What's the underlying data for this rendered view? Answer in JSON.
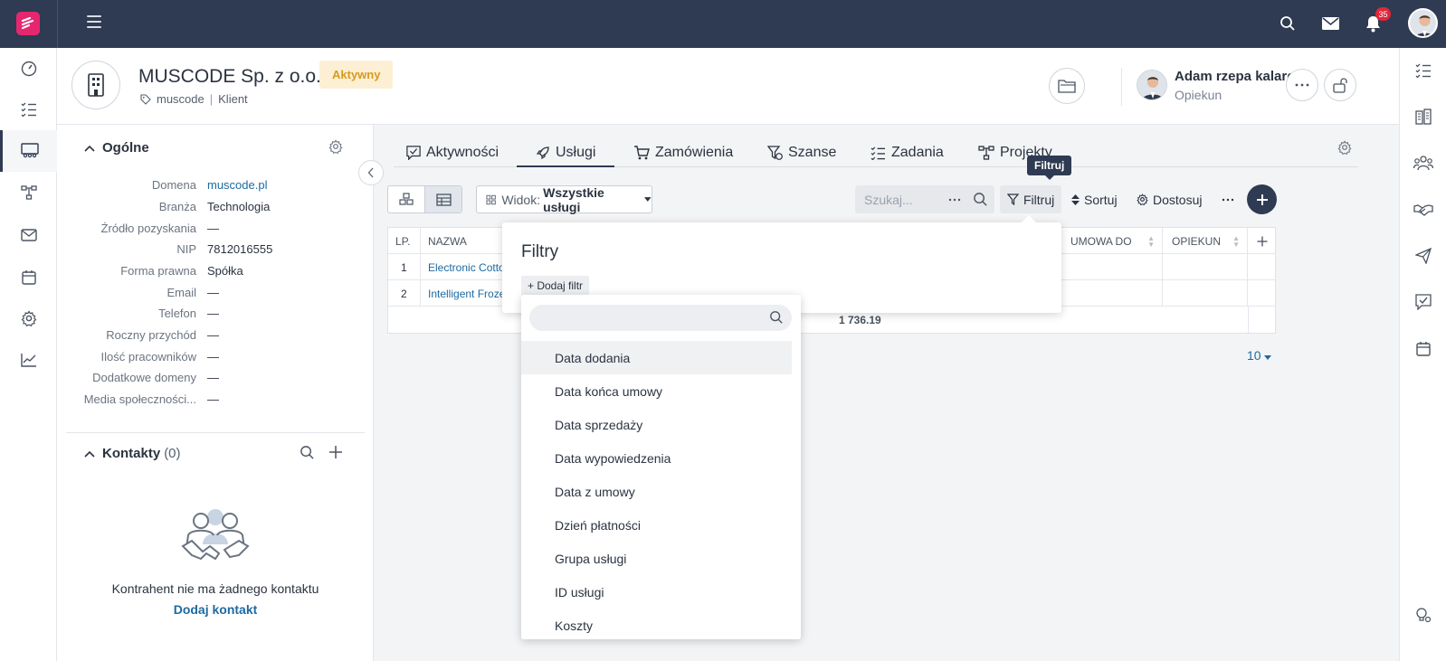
{
  "topbar": {
    "notification_count": "35"
  },
  "header": {
    "company_name": "MUSCODE Sp. z o.o.",
    "status": "Aktywny",
    "tag": "muscode",
    "type": "Klient",
    "owner_name": "Adam rzepa kalarepa",
    "owner_role": "Opiekun"
  },
  "general": {
    "title": "Ogólne",
    "fields": [
      {
        "label": "Domena",
        "value": "muscode.pl"
      },
      {
        "label": "Branża",
        "value": "Technologia"
      },
      {
        "label": "Źródło pozyskania",
        "value": "—"
      },
      {
        "label": "NIP",
        "value": "7812016555"
      },
      {
        "label": "Forma prawna",
        "value": "Spółka"
      },
      {
        "label": "Email",
        "value": "—"
      },
      {
        "label": "Telefon",
        "value": "—"
      },
      {
        "label": "Roczny przychód",
        "value": "—"
      },
      {
        "label": "Ilość pracowników",
        "value": "—"
      },
      {
        "label": "Dodatkowe domeny",
        "value": "—"
      },
      {
        "label": "Media społeczności...",
        "value": "—"
      }
    ]
  },
  "contacts": {
    "title": "Kontakty",
    "count": "(0)",
    "empty_text": "Kontrahent nie ma żadnego kontaktu",
    "add_label": "Dodaj kontakt"
  },
  "tabs": [
    {
      "label": "Aktywności"
    },
    {
      "label": "Usługi"
    },
    {
      "label": "Zamówienia"
    },
    {
      "label": "Szanse"
    },
    {
      "label": "Zadania"
    },
    {
      "label": "Projekty"
    }
  ],
  "toolbar": {
    "view_prefix": "Widok:",
    "view_value": "Wszystkie usługi",
    "search_placeholder": "Szukaj...",
    "filter_label": "Filtruj",
    "sort_label": "Sortuj",
    "customize_label": "Dostosuj",
    "tooltip": "Filtruj"
  },
  "table": {
    "headers": {
      "lp": "LP.",
      "name": "NAZWA",
      "contract_to": "UMOWA DO",
      "owner": "OPIEKUN"
    },
    "rows": [
      {
        "lp": "1",
        "name": "Electronic Cotton"
      },
      {
        "lp": "2",
        "name": "Intelligent Frozen"
      }
    ],
    "total": "1 736.19",
    "page_size": "10"
  },
  "filter_popup": {
    "title": "Filtry",
    "add_filter": "+ Dodaj filtr",
    "options": [
      "Data dodania",
      "Data końca umowy",
      "Data sprzedaży",
      "Data wypowiedzenia",
      "Data z umowy",
      "Dzień płatności",
      "Grupa usługi",
      "ID usługi",
      "Koszty"
    ]
  }
}
